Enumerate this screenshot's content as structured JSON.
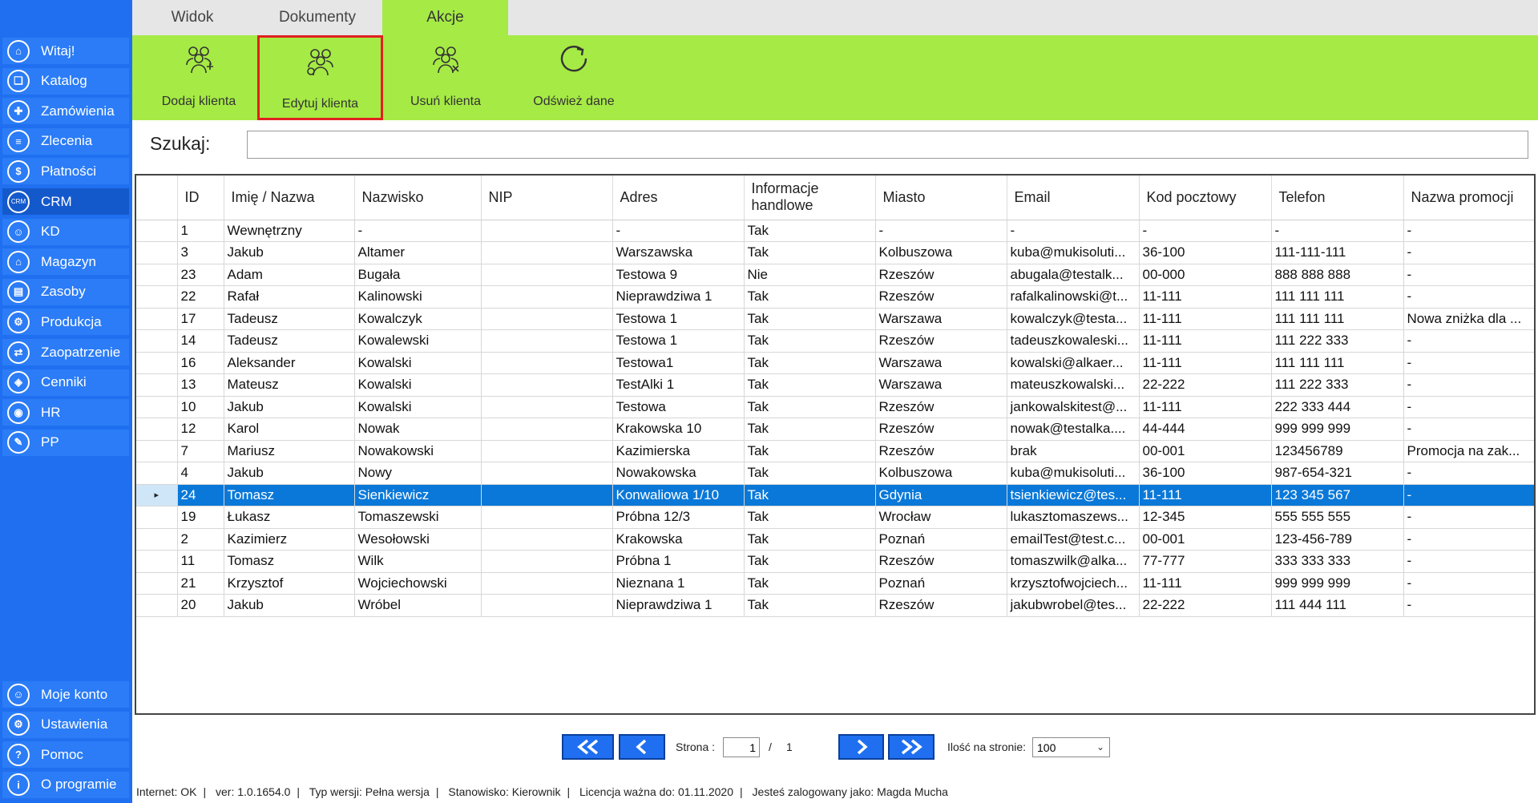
{
  "sidebar": {
    "items": [
      {
        "label": "Witaj!",
        "icon": "home-icon",
        "glyph": "⌂"
      },
      {
        "label": "Katalog",
        "icon": "book-icon",
        "glyph": "❏"
      },
      {
        "label": "Zamówienia",
        "icon": "cart-icon",
        "glyph": "✚"
      },
      {
        "label": "Zlecenia",
        "icon": "list-icon",
        "glyph": "≡"
      },
      {
        "label": "Płatności",
        "icon": "dollar-icon",
        "glyph": "$"
      },
      {
        "label": "CRM",
        "icon": "crm-icon",
        "glyph": "CRM"
      },
      {
        "label": "KD",
        "icon": "person-icon",
        "glyph": "☺"
      },
      {
        "label": "Magazyn",
        "icon": "warehouse-icon",
        "glyph": "⌂"
      },
      {
        "label": "Zasoby",
        "icon": "resources-icon",
        "glyph": "▤"
      },
      {
        "label": "Produkcja",
        "icon": "production-icon",
        "glyph": "⚙"
      },
      {
        "label": "Zaopatrzenie",
        "icon": "supply-icon",
        "glyph": "⇄"
      },
      {
        "label": "Cenniki",
        "icon": "price-tag-icon",
        "glyph": "◈"
      },
      {
        "label": "HR",
        "icon": "hr-icon",
        "glyph": "◉"
      },
      {
        "label": "PP",
        "icon": "pp-icon",
        "glyph": "✎"
      }
    ],
    "bottom_items": [
      {
        "label": "Moje konto",
        "icon": "account-icon",
        "glyph": "☺"
      },
      {
        "label": "Ustawienia",
        "icon": "gear-icon",
        "glyph": "⚙"
      },
      {
        "label": "Pomoc",
        "icon": "help-icon",
        "glyph": "?"
      },
      {
        "label": "O programie",
        "icon": "info-icon",
        "glyph": "i"
      }
    ]
  },
  "tabs": [
    "Widok",
    "Dokumenty",
    "Akcje"
  ],
  "ribbon": {
    "add_client": "Dodaj klienta",
    "edit_client": "Edytuj klienta",
    "delete_client": "Usuń klienta",
    "refresh": "Odśwież dane"
  },
  "search": {
    "label": "Szukaj:",
    "value": ""
  },
  "grid": {
    "headers": [
      "ID",
      "Imię / Nazwa",
      "Nazwisko",
      "NIP",
      "Adres",
      "Informacje handlowe",
      "Miasto",
      "Email",
      "Kod pocztowy",
      "Telefon",
      "Nazwa promocji"
    ],
    "rows": [
      [
        "1",
        "Wewnętrzny",
        "-",
        "",
        "-",
        "Tak",
        "-",
        "-",
        "-",
        "-",
        "-"
      ],
      [
        "3",
        "Jakub",
        "Altamer",
        "",
        "Warszawska",
        "Tak",
        "Kolbuszowa",
        "kuba@mukisoluti...",
        "36-100",
        "111-111-111",
        "-"
      ],
      [
        "23",
        "Adam",
        "Bugała",
        "",
        "Testowa 9",
        "Nie",
        "Rzeszów",
        "abugala@testalk...",
        "00-000",
        "888 888 888",
        "-"
      ],
      [
        "22",
        "Rafał",
        "Kalinowski",
        "",
        "Nieprawdziwa 1",
        "Tak",
        "Rzeszów",
        "rafalkalinowski@t...",
        "11-111",
        "111 111 111",
        "-"
      ],
      [
        "17",
        "Tadeusz",
        "Kowalczyk",
        "",
        "Testowa 1",
        "Tak",
        "Warszawa",
        "kowalczyk@testa...",
        "11-111",
        "111 111 111",
        "Nowa zniżka dla ..."
      ],
      [
        "14",
        "Tadeusz",
        "Kowalewski",
        "",
        "Testowa 1",
        "Tak",
        "Rzeszów",
        "tadeuszkowaleski...",
        "11-111",
        "111 222 333",
        "-"
      ],
      [
        "16",
        "Aleksander",
        "Kowalski",
        "",
        "Testowa1",
        "Tak",
        "Warszawa",
        "kowalski@alkaer...",
        "11-111",
        "111 111 111",
        "-"
      ],
      [
        "13",
        "Mateusz",
        "Kowalski",
        "",
        "TestAlki 1",
        "Tak",
        "Warszawa",
        "mateuszkowalski...",
        "22-222",
        "111 222 333",
        "-"
      ],
      [
        "10",
        "Jakub",
        "Kowalski",
        "",
        "Testowa",
        "Tak",
        "Rzeszów",
        "jankowalskitest@...",
        "11-111",
        "222 333 444",
        "-"
      ],
      [
        "12",
        "Karol",
        "Nowak",
        "",
        "Krakowska 10",
        "Tak",
        "Rzeszów",
        "nowak@testalka....",
        "44-444",
        "999 999 999",
        "-"
      ],
      [
        "7",
        "Mariusz",
        "Nowakowski",
        "",
        "Kazimierska",
        "Tak",
        "Rzeszów",
        "brak",
        "00-001",
        "123456789",
        "Promocja na zak..."
      ],
      [
        "4",
        "Jakub",
        "Nowy",
        "",
        "Nowakowska",
        "Tak",
        "Kolbuszowa",
        "kuba@mukisoluti...",
        "36-100",
        "987-654-321",
        "-"
      ],
      [
        "24",
        "Tomasz",
        "Sienkiewicz",
        "",
        "Konwaliowa 1/10",
        "Tak",
        "Gdynia",
        "tsienkiewicz@tes...",
        "11-111",
        "123 345 567",
        "-"
      ],
      [
        "19",
        "Łukasz",
        "Tomaszewski",
        "",
        "Próbna 12/3",
        "Tak",
        "Wrocław",
        "lukasztomaszews...",
        "12-345",
        "555 555 555",
        "-"
      ],
      [
        "2",
        "Kazimierz",
        "Wesołowski",
        "",
        "Krakowska",
        "Tak",
        "Poznań",
        "emailTest@test.c...",
        "00-001",
        "123-456-789",
        "-"
      ],
      [
        "11",
        "Tomasz",
        "Wilk",
        "",
        "Próbna 1",
        "Tak",
        "Rzeszów",
        "tomaszwilk@alka...",
        "77-777",
        "333 333 333",
        "-"
      ],
      [
        "21",
        "Krzysztof",
        "Wojciechowski",
        "",
        "Nieznana 1",
        "Tak",
        "Poznań",
        "krzysztofwojciech...",
        "11-111",
        "999 999 999",
        "-"
      ],
      [
        "20",
        "Jakub",
        "Wróbel",
        "",
        "Nieprawdziwa 1",
        "Tak",
        "Rzeszów",
        "jakubwrobel@tes...",
        "22-222",
        "111 444 111",
        "-"
      ]
    ],
    "selected_row": 12,
    "row_pointer_glyph": "▸"
  },
  "pager": {
    "page_label": "Strona :",
    "page_value": "1",
    "separator": "/",
    "total_pages": "1",
    "per_page_label": "Ilość na stronie:",
    "per_page_value": "100"
  },
  "status": {
    "internet": "Internet: OK",
    "version": "ver: 1.0.1654.0",
    "type": "Typ wersji: Pełna wersja",
    "station": "Stanowisko: Kierownik",
    "license": "Licencja ważna do: 01.11.2020",
    "user": "Jesteś zalogowany jako: Magda Mucha"
  },
  "colors": {
    "sidebar": "#1f6ff0",
    "ribbon": "#a6ea45",
    "selection": "#0a78d8",
    "highlight_border": "#e02020"
  }
}
